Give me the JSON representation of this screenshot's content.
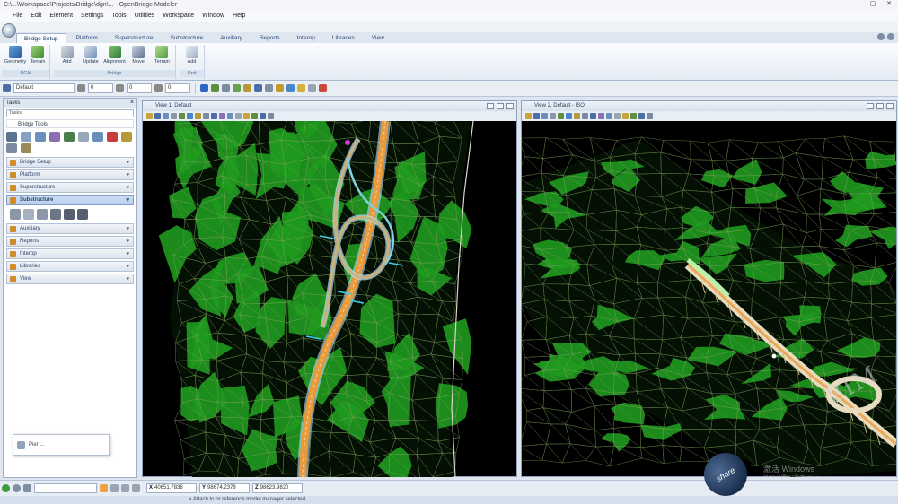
{
  "window": {
    "title": "C:\\...\\Workspace\\Projects\\Bridge\\dgn\\...  - OpenBridge Modeler",
    "controls": [
      "—",
      "▢",
      "✕"
    ]
  },
  "menu": [
    "File",
    "Edit",
    "Element",
    "Settings",
    "Tools",
    "Utilities",
    "Workspace",
    "Window",
    "Help"
  ],
  "ribbon": {
    "tabs": [
      "Bridge Setup",
      "Platform",
      "Superstructure",
      "Substructure",
      "Auxiliary",
      "Reports",
      "Interop",
      "Libraries",
      "View"
    ],
    "active_tab": "Bridge Setup",
    "groups": [
      {
        "name": "DGN",
        "buttons": [
          "Geometry",
          "Terrain"
        ]
      },
      {
        "name": "Bridge",
        "buttons": [
          "Add",
          "Update",
          "Alignment",
          "Move",
          "Terrain"
        ]
      },
      {
        "name": "Unit",
        "buttons": [
          "Add"
        ]
      }
    ]
  },
  "attributes": {
    "level": "Default",
    "color": "0",
    "weight": "0",
    "style": "0"
  },
  "tasks": {
    "title": "Tasks",
    "combo": "Tasks",
    "tree_item": "Bridge Tools",
    "sections": [
      "Bridge Setup",
      "Platform",
      "Superstructure",
      "Substructure",
      "Auxiliary",
      "Reports",
      "Interop",
      "Libraries",
      "View"
    ],
    "active_section": "Substructure"
  },
  "floating_window": {
    "label": "Pier ..."
  },
  "views": [
    {
      "title": "View 1, Default"
    },
    {
      "title": "View 2, Default - ISO"
    }
  ],
  "status": {
    "x_label": "X",
    "x_value": "40651.7836",
    "y_label": "Y",
    "y_value": "98674.2378",
    "z_label": "Z",
    "z_value": "98623.9820",
    "message": "> Attach to or reference model manager selected"
  },
  "watermark": {
    "line1": "激活 Windows",
    "line2": "转到“设置”以激活 Windows。",
    "share": "share"
  },
  "colors": {
    "terrain_green": "#1f9a1f",
    "mesh_line": "#7ea35a",
    "road_orange": "#e89a3c",
    "road_edge": "#b9e0ff",
    "accent": "#2b67c9"
  }
}
